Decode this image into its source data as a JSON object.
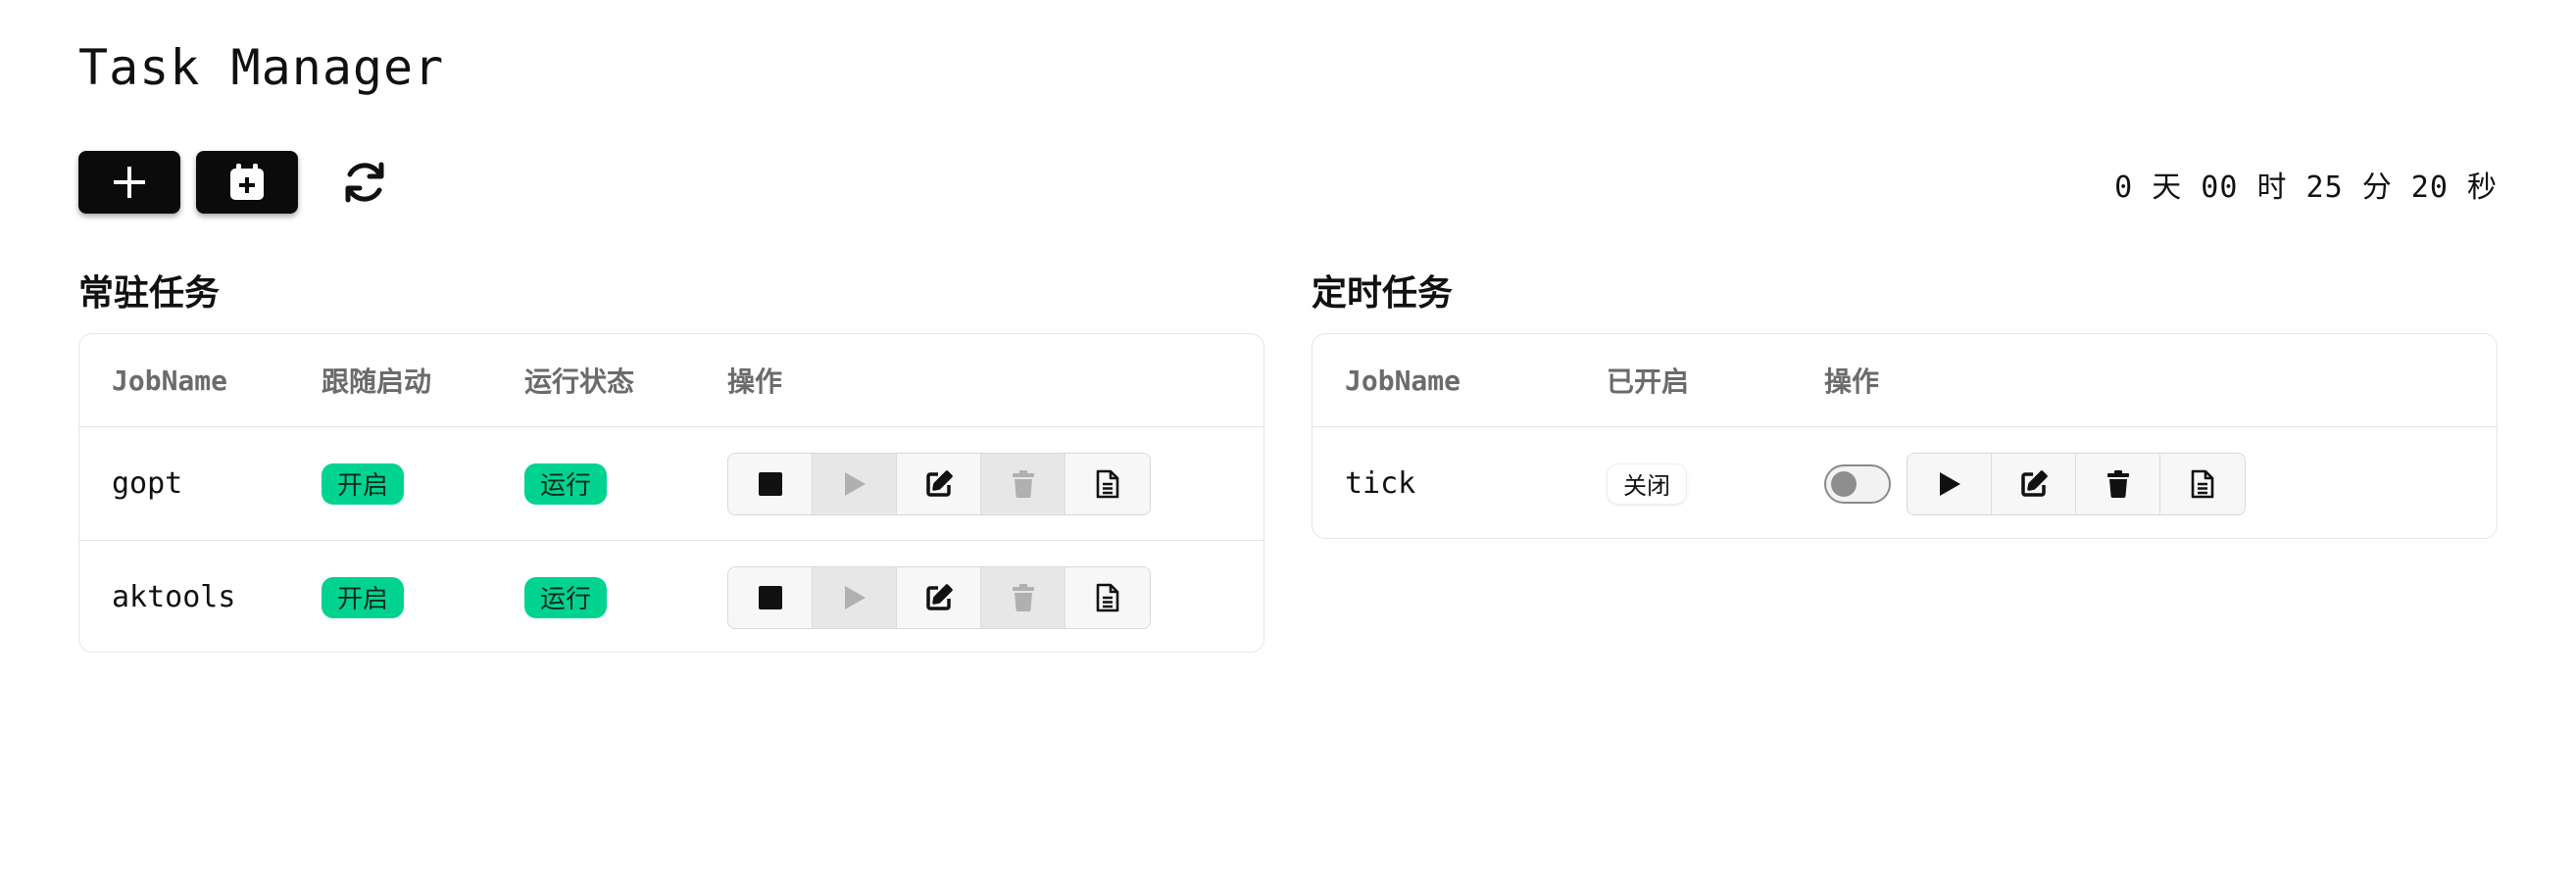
{
  "app": {
    "title": "Task Manager",
    "uptime": "0 天 00 时 25 分 20 秒"
  },
  "toolbar": {
    "add_icon": "plus-icon",
    "schedule_icon": "calendar-plus-icon",
    "refresh_icon": "refresh-icon"
  },
  "resident": {
    "title": "常驻任务",
    "columns": [
      "JobName",
      "跟随启动",
      "运行状态",
      "操作"
    ],
    "rows": [
      {
        "name": "gopt",
        "follow_start": "开启",
        "status": "运行"
      },
      {
        "name": "aktools",
        "follow_start": "开启",
        "status": "运行"
      }
    ]
  },
  "scheduled": {
    "title": "定时任务",
    "columns": [
      "JobName",
      "已开启",
      "操作"
    ],
    "rows": [
      {
        "name": "tick",
        "enabled": "关闭",
        "toggle_on": false
      }
    ]
  },
  "colors": {
    "badge_green": "#00d38f",
    "toolbar_black": "#0b0b0b",
    "border": "#e4e4e7"
  }
}
